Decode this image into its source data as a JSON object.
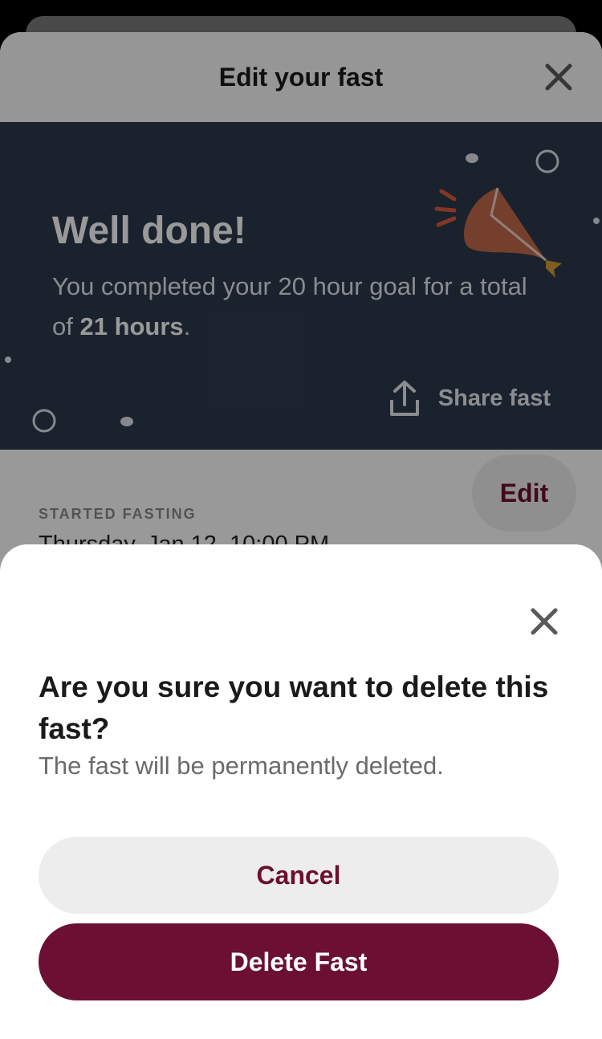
{
  "edit_sheet": {
    "title": "Edit your fast",
    "celebration": {
      "heading": "Well done!",
      "text_before": "You completed your 20 hour goal for a total of ",
      "text_bold": "21 hours",
      "text_after": ".",
      "share_label": "Share fast"
    },
    "started": {
      "label": "STARTED FASTING",
      "value": "Thursday, Jan 12, 10:00 PM",
      "edit_label": "Edit"
    }
  },
  "modal": {
    "title": "Are you sure you want to delete this fast?",
    "subtitle": "The fast will be permanently deleted.",
    "cancel_label": "Cancel",
    "delete_label": "Delete Fast"
  },
  "colors": {
    "brand": "#6b1033",
    "celebration_bg": "#2c3a4e",
    "cancel_bg": "#eeedee"
  },
  "icons": [
    "close-icon",
    "share-icon",
    "party-popper-icon"
  ]
}
